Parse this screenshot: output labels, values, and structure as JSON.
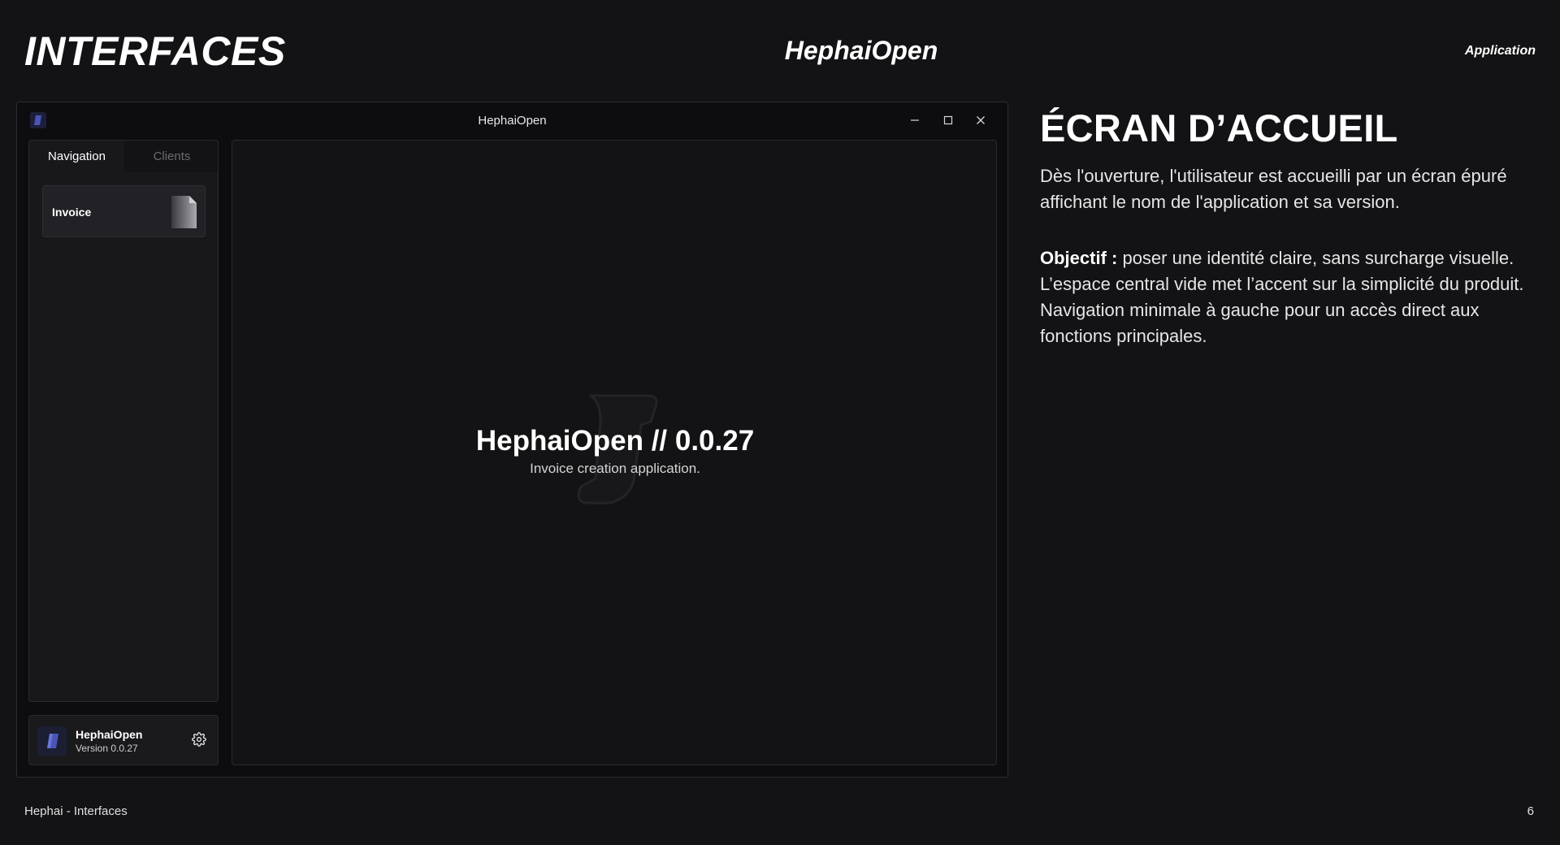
{
  "slide": {
    "title": "INTERFACES",
    "center_title": "HephaiOpen",
    "tag": "Application",
    "footer_left": "Hephai - Interfaces",
    "page_number": "6"
  },
  "window": {
    "title": "HephaiOpen",
    "controls": {
      "minimize_icon": "minimize-icon",
      "maximize_icon": "maximize-icon",
      "close_icon": "close-icon"
    },
    "tabs": [
      {
        "label": "Navigation",
        "active": true
      },
      {
        "label": "Clients",
        "active": false
      }
    ],
    "nav_items": [
      {
        "label": "Invoice",
        "icon": "document-icon"
      }
    ],
    "footer": {
      "app_name": "HephaiOpen",
      "version": "Version 0.0.27",
      "settings_icon": "gear-icon"
    },
    "main": {
      "title": "HephaiOpen // 0.0.27",
      "subtitle": "Invoice creation application."
    }
  },
  "description": {
    "heading": "ÉCRAN D’ACCUEIL",
    "paragraph1": "Dès l'ouverture, l'utilisateur est accueilli par un écran épuré affichant le nom de l'application et sa version.",
    "objective_label": "Objectif :",
    "paragraph2": " poser une identité claire, sans surcharge visuelle. L’espace central vide met l’accent sur la simplicité du produit. Navigation minimale à gauche pour un accès direct aux fonctions principales."
  },
  "colors": {
    "background": "#131316",
    "logo_accent": "#4a55b8"
  }
}
